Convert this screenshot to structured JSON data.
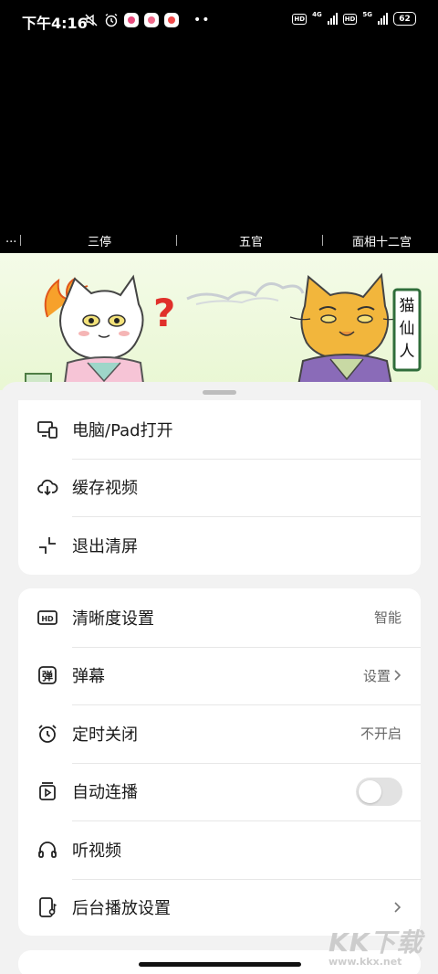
{
  "status_bar": {
    "time": "下午4:16",
    "network_1": "4G",
    "network_2": "5G",
    "hd_label": "HD",
    "battery": "62"
  },
  "chapters": {
    "items": [
      "...",
      "三停",
      "五官",
      "面相十二宫"
    ]
  },
  "banner": {
    "sign_text": "猫仙人",
    "question_mark": "?"
  },
  "menu": {
    "group1": [
      {
        "label": "电脑/Pad打开",
        "icon": "device-screen-icon"
      },
      {
        "label": "缓存视频",
        "icon": "cloud-download-icon"
      },
      {
        "label": "退出清屏",
        "icon": "exit-fullscreen-icon"
      }
    ],
    "group2": [
      {
        "label": "清晰度设置",
        "icon": "hd-icon",
        "value": "智能"
      },
      {
        "label": "弹幕",
        "icon": "danmaku-icon",
        "value": "设置"
      },
      {
        "label": "定时关闭",
        "icon": "alarm-clock-icon",
        "value": "不开启"
      },
      {
        "label": "自动连播",
        "icon": "autoplay-icon",
        "toggle": false
      },
      {
        "label": "听视频",
        "icon": "headphones-icon"
      },
      {
        "label": "后台播放设置",
        "icon": "phone-music-icon"
      }
    ]
  },
  "danmaku_glyph": "弹",
  "hd_glyph": "HD",
  "watermark": {
    "big": "KK下载",
    "small": "www.kkx.net"
  }
}
